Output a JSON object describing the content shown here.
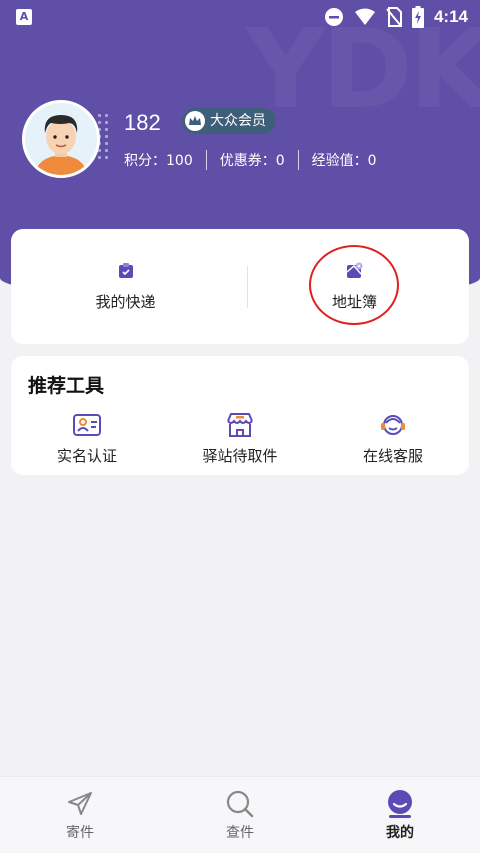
{
  "status_bar": {
    "time": "4:14",
    "left_icon": "a-icon"
  },
  "profile": {
    "user_id": "182",
    "member_level": "大众会员",
    "stats": [
      {
        "label": "积分：100"
      },
      {
        "label": "优惠券：0"
      },
      {
        "label": "经验值：0"
      }
    ]
  },
  "quick_actions": [
    {
      "label": "我的快递",
      "icon": "package-icon"
    },
    {
      "label": "地址簿",
      "icon": "map-icon"
    }
  ],
  "tools": {
    "title": "推荐工具",
    "items": [
      {
        "label": "实名认证",
        "icon": "id-card-icon"
      },
      {
        "label": "驿站待取件",
        "icon": "store-icon"
      },
      {
        "label": "在线客服",
        "icon": "customer-service-icon"
      }
    ]
  },
  "bottom_nav": [
    {
      "label": "寄件",
      "icon": "send-icon",
      "active": false
    },
    {
      "label": "查件",
      "icon": "search-icon",
      "active": false
    },
    {
      "label": "我的",
      "icon": "profile-icon",
      "active": true
    }
  ],
  "colors": {
    "header_bg": "#5f4fa6",
    "accent": "#5a4bb7",
    "badge_bg": "#3e5f79",
    "annotation": "#e02020"
  }
}
